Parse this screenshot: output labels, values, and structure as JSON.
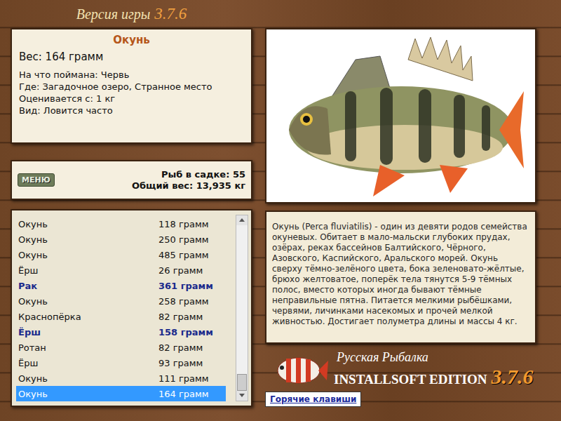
{
  "window": {
    "label": "Версия игры",
    "version": "3.7.6"
  },
  "catch": {
    "name": "Окунь",
    "weight": "Вес: 164 грамм",
    "details": [
      "На что поймана: Червь",
      "Где: Загадочное озеро, Странное место",
      "Оценивается с: 1 кг",
      "Вид: Ловится часто"
    ]
  },
  "keepnet": {
    "menu_button": "МЕНЮ",
    "count": "Рыб в садке: 55",
    "total": "Общий вес: 13,935 кг"
  },
  "list": {
    "scroll_position": 1,
    "rows": [
      {
        "name": "Окунь",
        "weight": "118 грамм",
        "trophy": false,
        "selected": false
      },
      {
        "name": "Окунь",
        "weight": "250 грамм",
        "trophy": false,
        "selected": false
      },
      {
        "name": "Окунь",
        "weight": "485 грамм",
        "trophy": false,
        "selected": false
      },
      {
        "name": "Ёрш",
        "weight": "26 грамм",
        "trophy": false,
        "selected": false
      },
      {
        "name": "Рак",
        "weight": "361 грамм",
        "trophy": true,
        "selected": false
      },
      {
        "name": "Окунь",
        "weight": "258 грамм",
        "trophy": false,
        "selected": false
      },
      {
        "name": "Краснопёрка",
        "weight": "82 грамм",
        "trophy": false,
        "selected": false
      },
      {
        "name": "Ёрш",
        "weight": "158 грамм",
        "trophy": true,
        "selected": false
      },
      {
        "name": "Ротан",
        "weight": "82 грамм",
        "trophy": false,
        "selected": false
      },
      {
        "name": "Ёрш",
        "weight": "93 грамм",
        "trophy": false,
        "selected": false
      },
      {
        "name": "Окунь",
        "weight": "111 грамм",
        "trophy": false,
        "selected": false
      },
      {
        "name": "Окунь",
        "weight": "164 грамм",
        "trophy": false,
        "selected": true
      }
    ]
  },
  "description": "Окунь (Perca fluviatilis) - один из девяти родов семейства окуневых. Обитает в мало-мальски глубоких прудах, озёрах, реках бассейнов Балтийского, Чёрного, Азовского, Каспийского, Аральского морей. Окунь сверху тёмно-зелёного цвета, бока зеленовато-жёлтые, брюхо желтоватое, поперёк тела тянутся 5-9 тёмных полос, вместо которых иногда бывают тёмные неправильные пятна. Питается мелкими рыбёшками, червями, личинками насекомых и прочей мелкой живностью. Достигает полуметра длины и массы 4 кг.",
  "logo": {
    "title": "Русская Рыбалка",
    "edition": "INSTALLSOFT EDITION",
    "version": "3.7.6"
  },
  "hotkeys_button": "Горячие клавиши"
}
